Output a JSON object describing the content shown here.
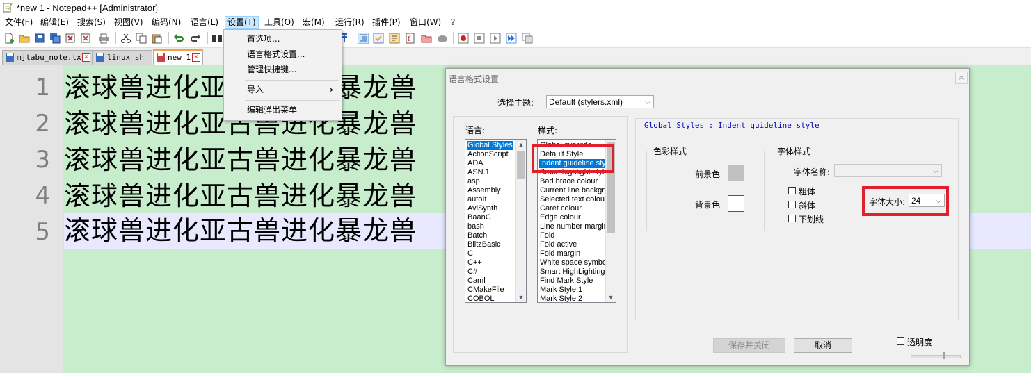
{
  "window": {
    "title": "*new 1 - Notepad++ [Administrator]"
  },
  "menubar": {
    "items": [
      "文件(F)",
      "编辑(E)",
      "搜索(S)",
      "视图(V)",
      "编码(N)",
      "语言(L)",
      "设置(T)",
      "工具(O)",
      "宏(M)",
      "运行(R)",
      "插件(P)",
      "窗口(W)",
      "?"
    ]
  },
  "tabs": [
    {
      "label": "mjtabu_note.txt"
    },
    {
      "label": "linux sh"
    },
    {
      "label": "new 1"
    }
  ],
  "editor": {
    "lines": [
      {
        "num": "1",
        "text": "滚球兽进化亚古兽进化暴龙兽"
      },
      {
        "num": "2",
        "text": "滚球兽进化亚古兽进化暴龙兽"
      },
      {
        "num": "3",
        "text": "滚球兽进化亚古兽进化暴龙兽"
      },
      {
        "num": "4",
        "text": "滚球兽进化亚古兽进化暴龙兽"
      },
      {
        "num": "5",
        "text": "滚球兽进化亚古兽进化暴龙兽"
      }
    ]
  },
  "settings_menu": {
    "items": [
      "首选项...",
      "语言格式设置...",
      "管理快捷键...",
      "导入",
      "编辑弹出菜单"
    ]
  },
  "dialog": {
    "title": "语言格式设置",
    "close": "×",
    "theme_label": "选择主题:",
    "theme_value": "Default (stylers.xml)",
    "language_label": "语言:",
    "style_label": "样式:",
    "languages": [
      "Global Styles",
      "ActionScript",
      "ADA",
      "ASN.1",
      "asp",
      "Assembly",
      "autoIt",
      "AviSynth",
      "BaanC",
      "bash",
      "Batch",
      "BlitzBasic",
      "C",
      "C++",
      "C#",
      "Caml",
      "CMakeFile",
      "COBOL"
    ],
    "styles": [
      "Global override",
      "Default Style",
      "Indent guideline style",
      "Brace highlight style",
      "Bad brace colour",
      "Current line background colour",
      "Selected text colour",
      "Caret colour",
      "Edge colour",
      "Line number margin",
      "Fold",
      "Fold active",
      "Fold margin",
      "White space symbol",
      "Smart HighLighting",
      "Find Mark Style",
      "Mark Style 1",
      "Mark Style 2"
    ],
    "heading": "Global Styles : Indent guideline style",
    "color_group": "色彩样式",
    "fg_label": "前景色",
    "bg_label": "背景色",
    "font_group": "字体样式",
    "font_name_label": "字体名称:",
    "font_name_value": "",
    "bold_label": "粗体",
    "italic_label": "斜体",
    "underline_label": "下划线",
    "font_size_label": "字体大小:",
    "font_size_value": "24",
    "save_close_label": "保存并关闭",
    "cancel_label": "取消",
    "transparency_label": "透明度"
  },
  "colors": {
    "editor_bg": "#c7edcc",
    "current_line": "#e8e8ff",
    "fg_swatch": "#c0c0c0",
    "bg_swatch": "#ffffff",
    "highlight_box": "#e0202a",
    "selection": "#0078d7",
    "heading_text": "#0000c0"
  }
}
